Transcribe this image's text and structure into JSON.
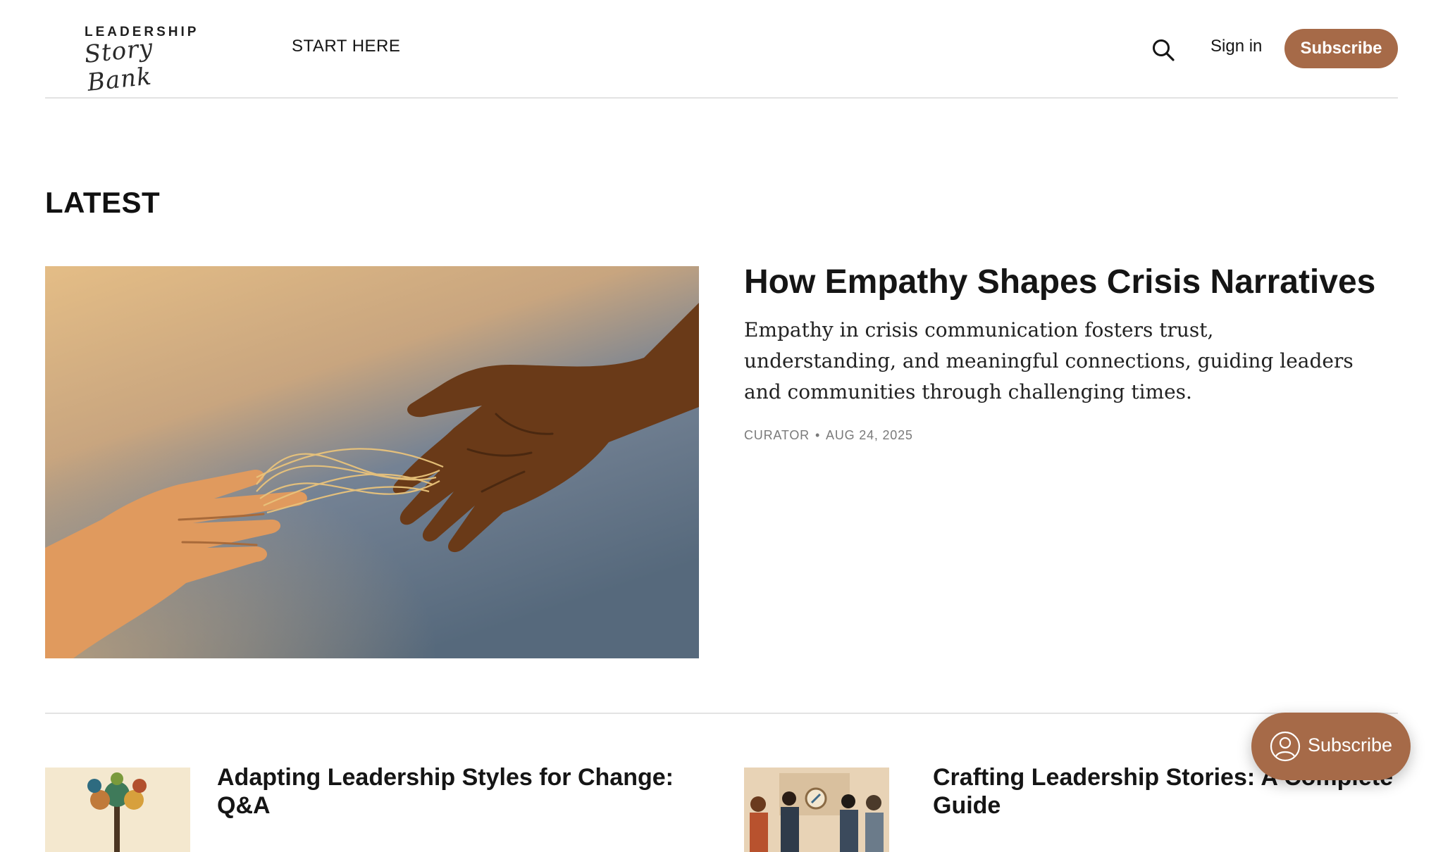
{
  "header": {
    "logo_top": "LEADERSHIP",
    "logo_script": "Story Bank",
    "nav_start": "START HERE",
    "signin": "Sign in",
    "subscribe": "Subscribe"
  },
  "latest": {
    "section_title": "LATEST",
    "hero": {
      "title": "How Empathy Shapes Crisis Narratives",
      "excerpt": "Empathy in crisis communication fosters trust, understanding, and meaningful connections, guiding leaders and communities through challenging times.",
      "author": "CURATOR",
      "date": "AUG 24, 2025"
    },
    "cards": [
      {
        "title": "Adapting Leadership Styles for Change: Q&A"
      },
      {
        "title": "Crafting Leadership Stories: A Complete Guide"
      }
    ]
  },
  "floating": {
    "subscribe": "Subscribe"
  },
  "colors": {
    "accent": "#a66a48",
    "text": "#151515",
    "divider": "#e3e3e3"
  },
  "icons": {
    "search": "search-icon",
    "subscribe": "person-circle-icon"
  }
}
